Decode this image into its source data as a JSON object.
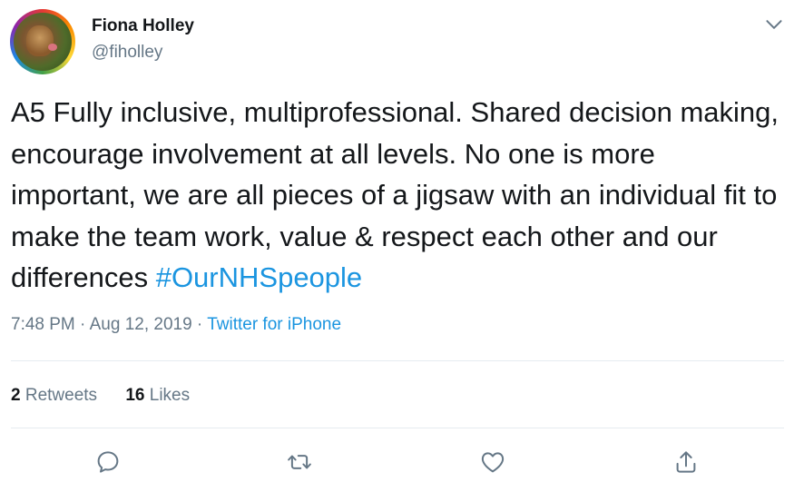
{
  "author": {
    "name": "Fiona Holley",
    "handle": "@fiholley"
  },
  "tweet": {
    "text": "A5 Fully inclusive, multiprofessional. Shared decision making, encourage involvement at all levels. No one is more important, we are all pieces of a jigsaw with an individual fit to make the team work, value & respect each other and our differences ",
    "hashtag": "#OurNHSpeople",
    "time": "7:48 PM",
    "sep1": " · ",
    "date": "Aug 12, 2019",
    "sep2": " · ",
    "source": "Twitter for iPhone"
  },
  "stats": {
    "retweets_count": "2",
    "retweets_label": "Retweets",
    "likes_count": "16",
    "likes_label": "Likes"
  },
  "icons": {
    "more": "chevron-down-icon",
    "reply": "reply-icon",
    "retweet": "retweet-icon",
    "like": "heart-icon",
    "share": "share-icon"
  },
  "colors": {
    "link": "#1b95e0",
    "secondary_text": "#657786",
    "primary_text": "#14171a",
    "divider": "#e6ecf0"
  }
}
